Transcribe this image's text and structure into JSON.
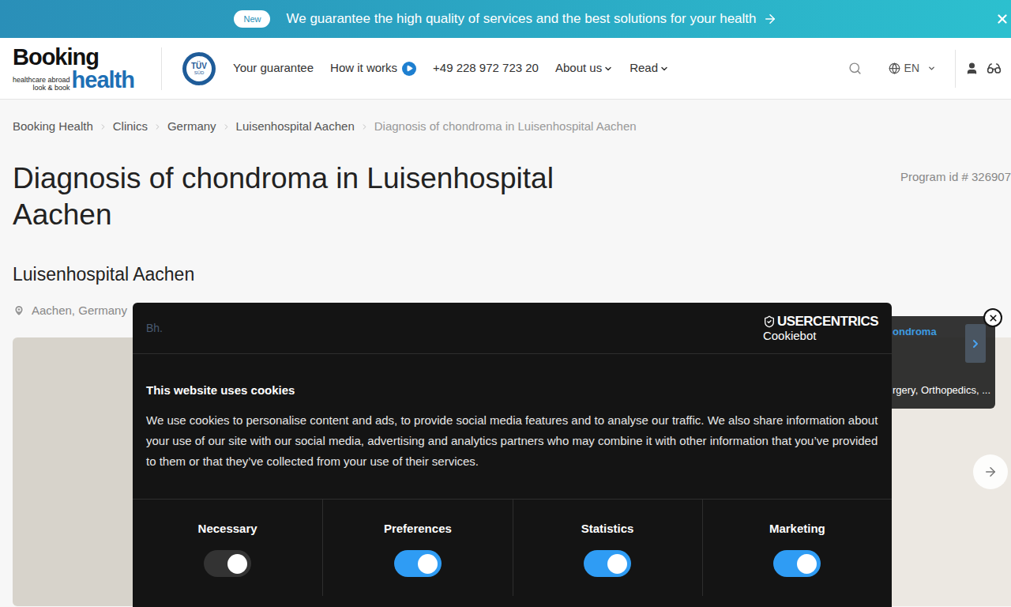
{
  "banner": {
    "badge": "New",
    "text": "We guarantee the high quality of services and the best solutions for your health"
  },
  "header": {
    "logo": {
      "top": "Booking",
      "tag1": "healthcare abroad",
      "tag2": "look & book",
      "bottom": "health"
    },
    "tuv": {
      "top": "TÜV",
      "bottom": "SÜD"
    },
    "nav": [
      {
        "label": "Your guarantee",
        "kind": "link"
      },
      {
        "label": "How it works",
        "kind": "play"
      },
      {
        "label": "+49 228 972 723 20",
        "kind": "link"
      },
      {
        "label": "About us",
        "kind": "dropdown"
      },
      {
        "label": "Read",
        "kind": "dropdown"
      }
    ],
    "language": "EN"
  },
  "breadcrumb": [
    {
      "label": "Booking Health",
      "current": false
    },
    {
      "label": "Clinics",
      "current": false
    },
    {
      "label": "Germany",
      "current": false
    },
    {
      "label": "Luisenhospital Aachen",
      "current": false
    },
    {
      "label": "Diagnosis of chondroma in Luisenhospital Aachen",
      "current": true
    }
  ],
  "title": "Diagnosis of chondroma in Luisenhospital Aachen",
  "program_id": "Program id # 326907",
  "clinic": "Luisenhospital Aachen",
  "location": "Aachen, Germany",
  "side_card": {
    "title": "ondroma",
    "subtitle": "rgery, Orthopedics, ..."
  },
  "cookie_dialog": {
    "brand": "Bh.",
    "vendor_top": "USERCENTRICS",
    "vendor_bottom": "Cookiebot",
    "heading": "This website uses cookies",
    "body": "We use cookies to personalise content and ads, to provide social media features and to analyse our traffic. We also share information about your use of our site with our social media, advertising and analytics partners who may combine it with other information that you’ve provided to them or that they’ve collected from your use of their services.",
    "categories": [
      {
        "label": "Necessary",
        "on": true,
        "disabled": true
      },
      {
        "label": "Preferences",
        "on": true,
        "disabled": false
      },
      {
        "label": "Statistics",
        "on": true,
        "disabled": false
      },
      {
        "label": "Marketing",
        "on": true,
        "disabled": false
      }
    ]
  }
}
